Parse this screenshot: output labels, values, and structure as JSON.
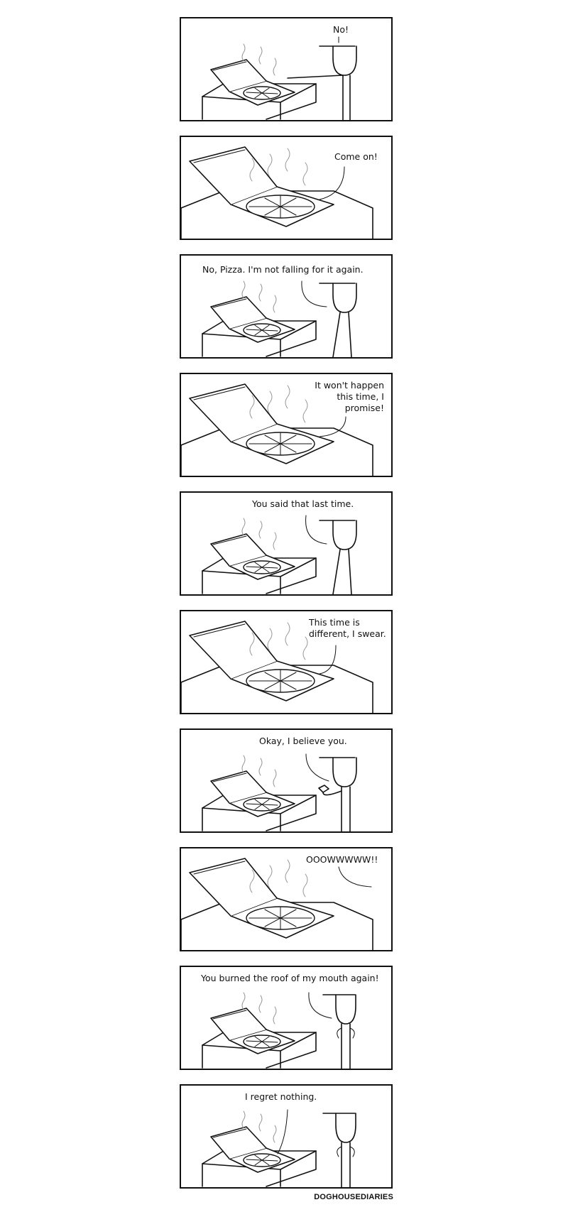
{
  "comic": {
    "panels": [
      {
        "text": "No!",
        "speaker": "person"
      },
      {
        "text": "Come on!",
        "speaker": "pizza"
      },
      {
        "text": "No, Pizza.  I'm not falling for it again.",
        "speaker": "person"
      },
      {
        "text": "It won't happen\nthis time, I\npromise!",
        "speaker": "pizza"
      },
      {
        "text": "You said that last time.",
        "speaker": "person"
      },
      {
        "text": "This time is\ndifferent, I swear.",
        "speaker": "pizza"
      },
      {
        "text": "Okay, I believe you.",
        "speaker": "person"
      },
      {
        "text": "OOOWWWWW!!",
        "speaker": "person"
      },
      {
        "text": "You burned the roof of my mouth again!",
        "speaker": "person"
      },
      {
        "text": "I regret nothing.",
        "speaker": "pizza"
      }
    ],
    "credit": "DOGHOUSEDIARIES"
  }
}
